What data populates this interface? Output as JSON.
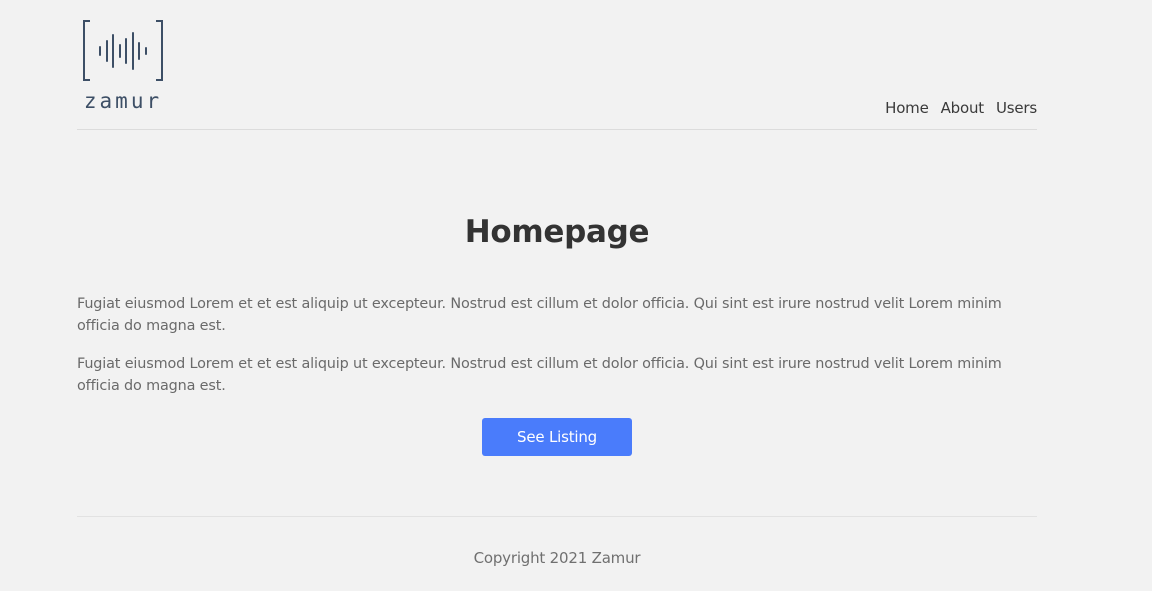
{
  "header": {
    "logo": {
      "wordmark": "zamur",
      "icon": "soundwave-bracket-icon",
      "color": "#3d4f66"
    },
    "nav": [
      {
        "label": "Home"
      },
      {
        "label": "About"
      },
      {
        "label": "Users"
      }
    ]
  },
  "main": {
    "title": "Homepage",
    "paragraphs": [
      "Fugiat eiusmod Lorem et et est aliquip ut excepteur. Nostrud est cillum et dolor officia. Qui sint est irure nostrud velit Lorem minim officia do magna est.",
      "Fugiat eiusmod Lorem et et est aliquip ut excepteur. Nostrud est cillum et dolor officia. Qui sint est irure nostrud velit Lorem minim officia do magna est."
    ],
    "cta_label": "See Listing"
  },
  "footer": {
    "copyright": "Copyright 2021 Zamur"
  },
  "colors": {
    "background": "#f2f2f2",
    "accent": "#4a7cfb",
    "text": "#333333",
    "muted_text": "#6a6a6a"
  }
}
